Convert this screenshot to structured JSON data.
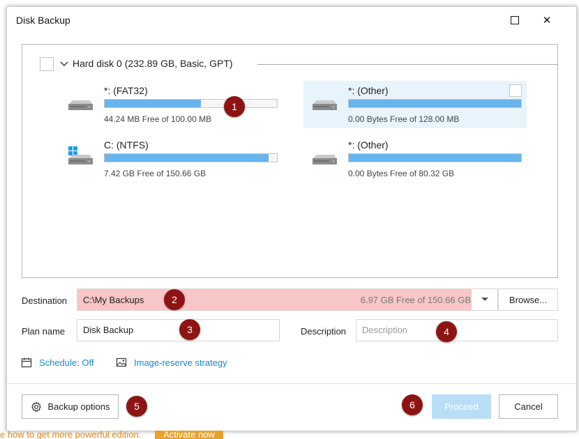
{
  "window": {
    "title": "Disk Backup",
    "maximize_glyph": "",
    "close_glyph": "✕"
  },
  "disk": {
    "title": "Hard disk 0 (232.89 GB, Basic, GPT)",
    "checked": false,
    "partitions": [
      {
        "name": "*: (FAT32)",
        "free": "44.24 MB Free of 100.00 MB",
        "used_fraction": 0.56,
        "icon": "drive-icon",
        "selected": false
      },
      {
        "name": "*: (Other)",
        "free": "0.00 Bytes Free of 128.00 MB",
        "used_fraction": 1.0,
        "icon": "drive-icon",
        "selected": true
      },
      {
        "name": "C: (NTFS)",
        "free": "7.42 GB Free of 150.66 GB",
        "used_fraction": 0.95,
        "icon": "windows-drive-icon",
        "selected": false
      },
      {
        "name": "*: (Other)",
        "free": "0.00 Bytes Free of 80.32 GB",
        "used_fraction": 1.0,
        "icon": "drive-icon",
        "selected": false
      }
    ]
  },
  "destination": {
    "label": "Destination",
    "path": "C:\\My Backups",
    "free": "6.97 GB Free of 150.66 GB",
    "browse_label": "Browse..."
  },
  "plan": {
    "label": "Plan name",
    "value": "Disk Backup"
  },
  "description": {
    "label": "Description",
    "placeholder": "Description"
  },
  "links": {
    "schedule": "Schedule: Off",
    "image_reserve": "Image-reserve strategy"
  },
  "footer": {
    "backup_options": "Backup options",
    "proceed": "Proceed",
    "cancel": "Cancel"
  },
  "badges": [
    "1",
    "2",
    "3",
    "4",
    "5",
    "6"
  ],
  "promo": {
    "text": "e how to get more powerful edition.",
    "button": "Activate now"
  },
  "colors": {
    "accent": "#1a87d0",
    "bar_fill": "#66b5ef",
    "destination_highlight": "#f7c6c6",
    "badge": "#8e1414",
    "promo": "#e0891a"
  }
}
